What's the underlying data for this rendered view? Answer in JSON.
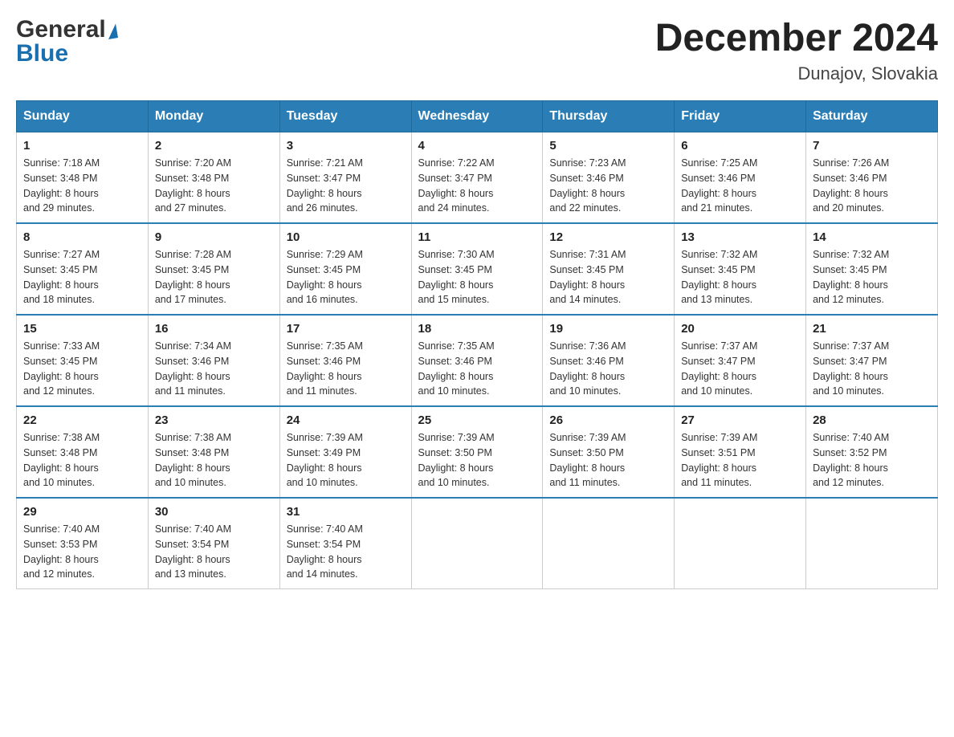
{
  "header": {
    "logo": {
      "general": "General",
      "triangle": "▶",
      "blue": "Blue"
    },
    "title": "December 2024",
    "subtitle": "Dunajov, Slovakia"
  },
  "columns": [
    "Sunday",
    "Monday",
    "Tuesday",
    "Wednesday",
    "Thursday",
    "Friday",
    "Saturday"
  ],
  "weeks": [
    [
      {
        "day": "1",
        "sunrise": "7:18 AM",
        "sunset": "3:48 PM",
        "daylight": "8 hours and 29 minutes."
      },
      {
        "day": "2",
        "sunrise": "7:20 AM",
        "sunset": "3:48 PM",
        "daylight": "8 hours and 27 minutes."
      },
      {
        "day": "3",
        "sunrise": "7:21 AM",
        "sunset": "3:47 PM",
        "daylight": "8 hours and 26 minutes."
      },
      {
        "day": "4",
        "sunrise": "7:22 AM",
        "sunset": "3:47 PM",
        "daylight": "8 hours and 24 minutes."
      },
      {
        "day": "5",
        "sunrise": "7:23 AM",
        "sunset": "3:46 PM",
        "daylight": "8 hours and 22 minutes."
      },
      {
        "day": "6",
        "sunrise": "7:25 AM",
        "sunset": "3:46 PM",
        "daylight": "8 hours and 21 minutes."
      },
      {
        "day": "7",
        "sunrise": "7:26 AM",
        "sunset": "3:46 PM",
        "daylight": "8 hours and 20 minutes."
      }
    ],
    [
      {
        "day": "8",
        "sunrise": "7:27 AM",
        "sunset": "3:45 PM",
        "daylight": "8 hours and 18 minutes."
      },
      {
        "day": "9",
        "sunrise": "7:28 AM",
        "sunset": "3:45 PM",
        "daylight": "8 hours and 17 minutes."
      },
      {
        "day": "10",
        "sunrise": "7:29 AM",
        "sunset": "3:45 PM",
        "daylight": "8 hours and 16 minutes."
      },
      {
        "day": "11",
        "sunrise": "7:30 AM",
        "sunset": "3:45 PM",
        "daylight": "8 hours and 15 minutes."
      },
      {
        "day": "12",
        "sunrise": "7:31 AM",
        "sunset": "3:45 PM",
        "daylight": "8 hours and 14 minutes."
      },
      {
        "day": "13",
        "sunrise": "7:32 AM",
        "sunset": "3:45 PM",
        "daylight": "8 hours and 13 minutes."
      },
      {
        "day": "14",
        "sunrise": "7:32 AM",
        "sunset": "3:45 PM",
        "daylight": "8 hours and 12 minutes."
      }
    ],
    [
      {
        "day": "15",
        "sunrise": "7:33 AM",
        "sunset": "3:45 PM",
        "daylight": "8 hours and 12 minutes."
      },
      {
        "day": "16",
        "sunrise": "7:34 AM",
        "sunset": "3:46 PM",
        "daylight": "8 hours and 11 minutes."
      },
      {
        "day": "17",
        "sunrise": "7:35 AM",
        "sunset": "3:46 PM",
        "daylight": "8 hours and 11 minutes."
      },
      {
        "day": "18",
        "sunrise": "7:35 AM",
        "sunset": "3:46 PM",
        "daylight": "8 hours and 10 minutes."
      },
      {
        "day": "19",
        "sunrise": "7:36 AM",
        "sunset": "3:46 PM",
        "daylight": "8 hours and 10 minutes."
      },
      {
        "day": "20",
        "sunrise": "7:37 AM",
        "sunset": "3:47 PM",
        "daylight": "8 hours and 10 minutes."
      },
      {
        "day": "21",
        "sunrise": "7:37 AM",
        "sunset": "3:47 PM",
        "daylight": "8 hours and 10 minutes."
      }
    ],
    [
      {
        "day": "22",
        "sunrise": "7:38 AM",
        "sunset": "3:48 PM",
        "daylight": "8 hours and 10 minutes."
      },
      {
        "day": "23",
        "sunrise": "7:38 AM",
        "sunset": "3:48 PM",
        "daylight": "8 hours and 10 minutes."
      },
      {
        "day": "24",
        "sunrise": "7:39 AM",
        "sunset": "3:49 PM",
        "daylight": "8 hours and 10 minutes."
      },
      {
        "day": "25",
        "sunrise": "7:39 AM",
        "sunset": "3:50 PM",
        "daylight": "8 hours and 10 minutes."
      },
      {
        "day": "26",
        "sunrise": "7:39 AM",
        "sunset": "3:50 PM",
        "daylight": "8 hours and 11 minutes."
      },
      {
        "day": "27",
        "sunrise": "7:39 AM",
        "sunset": "3:51 PM",
        "daylight": "8 hours and 11 minutes."
      },
      {
        "day": "28",
        "sunrise": "7:40 AM",
        "sunset": "3:52 PM",
        "daylight": "8 hours and 12 minutes."
      }
    ],
    [
      {
        "day": "29",
        "sunrise": "7:40 AM",
        "sunset": "3:53 PM",
        "daylight": "8 hours and 12 minutes."
      },
      {
        "day": "30",
        "sunrise": "7:40 AM",
        "sunset": "3:54 PM",
        "daylight": "8 hours and 13 minutes."
      },
      {
        "day": "31",
        "sunrise": "7:40 AM",
        "sunset": "3:54 PM",
        "daylight": "8 hours and 14 minutes."
      },
      null,
      null,
      null,
      null
    ]
  ],
  "labels": {
    "sunrise": "Sunrise:",
    "sunset": "Sunset:",
    "daylight": "Daylight:"
  }
}
